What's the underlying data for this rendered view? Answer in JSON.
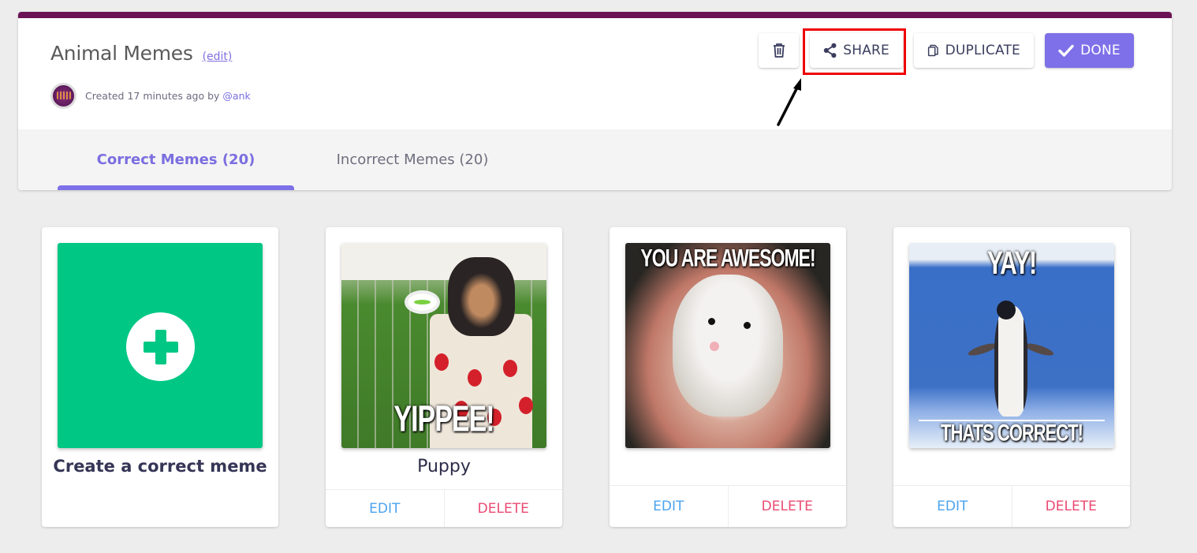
{
  "header": {
    "title": "Animal Memes",
    "edit_link": "(edit)",
    "meta_prefix": "Created 17 minutes ago by ",
    "meta_user": "@ank",
    "accent_bar_color": "#6b1256"
  },
  "actions": {
    "delete_icon": "trash-icon",
    "share_label": "SHARE",
    "share_icon": "share-icon",
    "duplicate_label": "DUPLICATE",
    "duplicate_icon": "copy-icon",
    "done_label": "DONE",
    "done_icon": "check-icon",
    "done_color": "#7e70e8",
    "highlight_color": "#ee0000"
  },
  "tabs": [
    {
      "label": "Correct Memes (20)",
      "active": true
    },
    {
      "label": "Incorrect Memes (20)",
      "active": false
    }
  ],
  "cards": {
    "create": {
      "label": "Create a correct meme",
      "icon": "plus-circle-icon",
      "color": "#00c884"
    },
    "items": [
      {
        "caption": "Puppy",
        "meme_text": "YIPPEE!",
        "edit_label": "EDIT",
        "delete_label": "DELETE"
      },
      {
        "caption": "",
        "meme_text": "YOU ARE AWESOME!",
        "edit_label": "EDIT",
        "delete_label": "DELETE"
      },
      {
        "caption": "",
        "meme_text_top": "YAY!",
        "meme_text_bottom": "THATS CORRECT!",
        "edit_label": "EDIT",
        "delete_label": "DELETE"
      }
    ]
  }
}
